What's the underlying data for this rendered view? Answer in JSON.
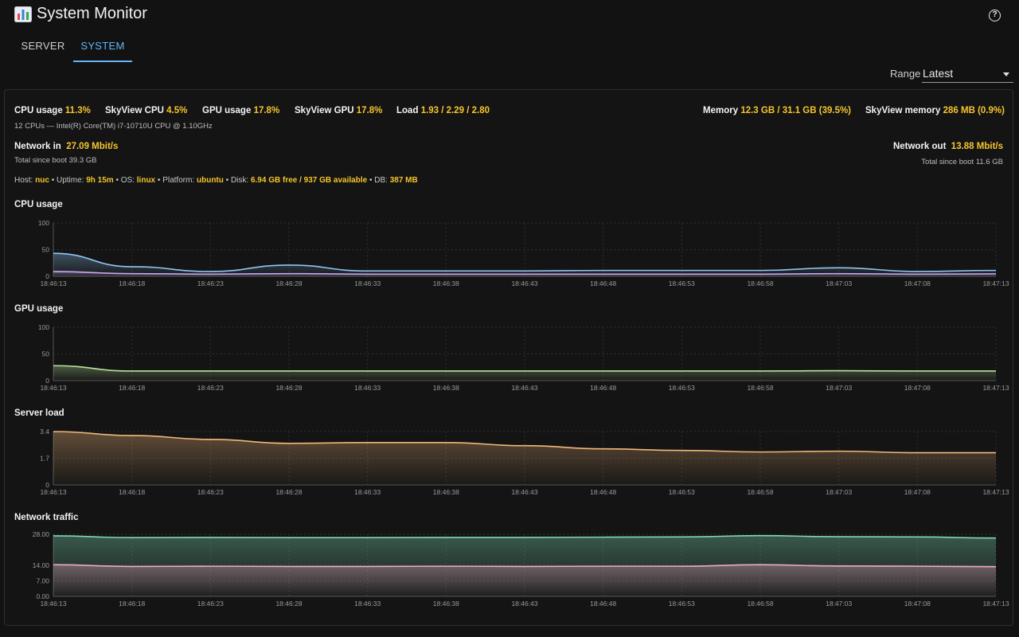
{
  "app": {
    "title": "System Monitor",
    "icon": "bar-chart-icon",
    "help_icon": "help-circle-icon"
  },
  "tabs": [
    {
      "label": "SERVER",
      "active": false
    },
    {
      "label": "SYSTEM",
      "active": true
    }
  ],
  "range": {
    "label": "Range",
    "value": "Latest"
  },
  "stats": {
    "cpu_usage": {
      "label": "CPU usage",
      "value": "11.3%"
    },
    "skyview_cpu": {
      "label": "SkyView CPU",
      "value": "4.5%"
    },
    "gpu_usage": {
      "label": "GPU usage",
      "value": "17.8%"
    },
    "skyview_gpu": {
      "label": "SkyView GPU",
      "value": "17.8%"
    },
    "load": {
      "label": "Load",
      "value": "1.93 / 2.29 / 2.80"
    },
    "memory": {
      "label": "Memory",
      "value": "12.3 GB / 31.1 GB (39.5%)"
    },
    "skyview_memory": {
      "label": "SkyView memory",
      "value": "286 MB (0.9%)"
    },
    "cpu_info": "12 CPUs — Intel(R) Core(TM) i7-10710U CPU @ 1.10GHz",
    "network_in": {
      "label": "Network in",
      "value": "27.09 Mbit/s",
      "total": "Total since boot 39.3 GB"
    },
    "network_out": {
      "label": "Network out",
      "value": "13.88 Mbit/s",
      "total": "Total since boot 11.6 GB"
    }
  },
  "host_line": {
    "host_label": "Host:",
    "host": "nuc",
    "uptime_label": "Uptime:",
    "uptime": "9h 15m",
    "os_label": "OS:",
    "os": "linux",
    "platform_label": "Platform:",
    "platform": "ubuntu",
    "disk_label": "Disk:",
    "disk": "6.94 GB free / 937 GB available",
    "db_label": "DB:",
    "db": "387 MB",
    "separator": "•"
  },
  "colors": {
    "accent": "#64b5f6",
    "value": "#f6c52c",
    "cpu": "#8ec5f5",
    "cpu_skyview": "#c8a7f0",
    "gpu": "#b6e39a",
    "load": "#f1b77a",
    "net_in": "#7fd8b4",
    "net_out": "#f0a8c4"
  },
  "chart_data": [
    {
      "id": "cpu",
      "title": "CPU usage",
      "type": "area",
      "x": [
        "18:46:13",
        "18:46:18",
        "18:46:23",
        "18:46:28",
        "18:46:33",
        "18:46:38",
        "18:46:43",
        "18:46:48",
        "18:46:53",
        "18:46:58",
        "18:47:03",
        "18:47:08",
        "18:47:13"
      ],
      "ylim": [
        0,
        100
      ],
      "yticks": [
        "100",
        "50",
        "0"
      ],
      "ytick_values": [
        100,
        50,
        0
      ],
      "series": [
        {
          "values": [
            43,
            18,
            9,
            21,
            10,
            10,
            10,
            11,
            11,
            11,
            16,
            9,
            11
          ],
          "color": "#8ec5f5"
        },
        {
          "values": [
            9,
            5,
            4,
            5,
            4,
            4,
            4,
            4,
            4,
            4,
            5,
            4,
            4.5
          ],
          "color": "#c8a7f0"
        }
      ]
    },
    {
      "id": "gpu",
      "title": "GPU usage",
      "type": "area",
      "x": [
        "18:46:13",
        "18:46:18",
        "18:46:23",
        "18:46:28",
        "18:46:33",
        "18:46:38",
        "18:46:43",
        "18:46:48",
        "18:46:53",
        "18:46:58",
        "18:47:03",
        "18:47:08",
        "18:47:13"
      ],
      "ylim": [
        0,
        100
      ],
      "yticks": [
        "100",
        "50",
        "0"
      ],
      "ytick_values": [
        100,
        50,
        0
      ],
      "series": [
        {
          "values": [
            28,
            18,
            18,
            18,
            18,
            18,
            18,
            18,
            18,
            18,
            18.5,
            18,
            18
          ],
          "color": "#b6e39a"
        }
      ]
    },
    {
      "id": "load",
      "title": "Server load",
      "type": "area",
      "x": [
        "18:46:13",
        "18:46:18",
        "18:46:23",
        "18:46:28",
        "18:46:33",
        "18:46:38",
        "18:46:43",
        "18:46:48",
        "18:46:53",
        "18:46:58",
        "18:47:03",
        "18:47:08",
        "18:47:13"
      ],
      "ylim": [
        0,
        3.4
      ],
      "yticks": [
        "3.4",
        "1.7",
        "0"
      ],
      "ytick_values": [
        3.4,
        1.7,
        0
      ],
      "series": [
        {
          "values": [
            3.4,
            3.15,
            2.9,
            2.65,
            2.7,
            2.7,
            2.5,
            2.3,
            2.2,
            2.1,
            2.15,
            2.05,
            2.05
          ],
          "color": "#f1b77a"
        }
      ]
    },
    {
      "id": "network",
      "title": "Network traffic",
      "type": "area",
      "x": [
        "18:46:13",
        "18:46:18",
        "18:46:23",
        "18:46:28",
        "18:46:33",
        "18:46:38",
        "18:46:43",
        "18:46:48",
        "18:46:53",
        "18:46:58",
        "18:47:03",
        "18:47:08",
        "18:47:13"
      ],
      "ylim": [
        0,
        28
      ],
      "yticks": [
        "28.00",
        "14.00",
        "7.00",
        "0.00"
      ],
      "ytick_values": [
        28,
        14,
        7,
        0
      ],
      "series": [
        {
          "values": [
            27.3,
            26.5,
            26.6,
            26.5,
            26.5,
            26.6,
            26.6,
            26.7,
            26.8,
            27.4,
            26.9,
            26.8,
            26.3
          ],
          "color": "#7fd8b4"
        },
        {
          "values": [
            14.3,
            13.5,
            13.6,
            13.5,
            13.5,
            13.6,
            13.5,
            13.6,
            13.6,
            14.3,
            13.7,
            13.6,
            13.4
          ],
          "color": "#f0a8c4"
        }
      ]
    }
  ]
}
